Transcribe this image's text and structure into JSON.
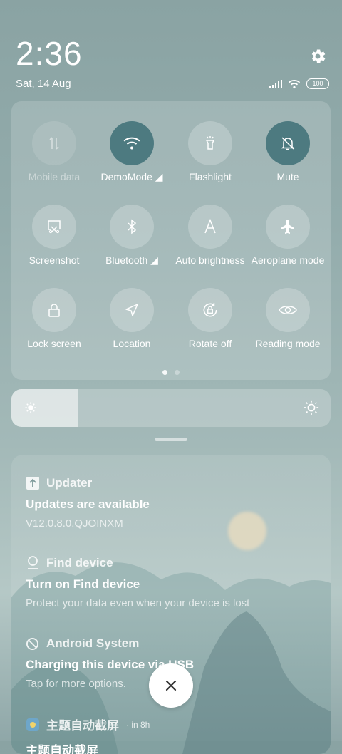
{
  "header": {
    "time": "2:36",
    "date": "Sat, 14 Aug",
    "battery": "100"
  },
  "tiles": [
    {
      "label": "Mobile data",
      "icon": "mobile-data-icon",
      "state": "disabled"
    },
    {
      "label": "DemoMode ◢",
      "icon": "wifi-icon",
      "state": "on"
    },
    {
      "label": "Flashlight",
      "icon": "flashlight-icon",
      "state": "off"
    },
    {
      "label": "Mute",
      "icon": "mute-bell-icon",
      "state": "on"
    },
    {
      "label": "Screenshot",
      "icon": "screenshot-icon",
      "state": "off"
    },
    {
      "label": "Bluetooth ◢",
      "icon": "bluetooth-icon",
      "state": "off"
    },
    {
      "label": "Auto brightness",
      "icon": "auto-brightness-icon",
      "state": "off"
    },
    {
      "label": "Aeroplane mode",
      "icon": "airplane-icon",
      "state": "off"
    },
    {
      "label": "Lock screen",
      "icon": "lock-icon",
      "state": "off"
    },
    {
      "label": "Location",
      "icon": "location-icon",
      "state": "off"
    },
    {
      "label": "Rotate off",
      "icon": "rotate-lock-icon",
      "state": "off"
    },
    {
      "label": "Reading mode",
      "icon": "eye-icon",
      "state": "off"
    }
  ],
  "brightness": {
    "level": 0.21
  },
  "notifications": [
    {
      "app": "Updater",
      "title": "Updates are available",
      "body": "V12.0.8.0.QJOINXM"
    },
    {
      "app": "Find device",
      "title": "Turn on Find device",
      "body": "Protect your data even when your device is lost"
    },
    {
      "app": "Android System",
      "title": "Charging this device via USB",
      "body": "Tap for more options."
    },
    {
      "app": "主题自动截屏",
      "time": "· in 8h",
      "title": "主题自动截屏"
    }
  ],
  "colors": {
    "active_tile": "#4d7a80"
  }
}
